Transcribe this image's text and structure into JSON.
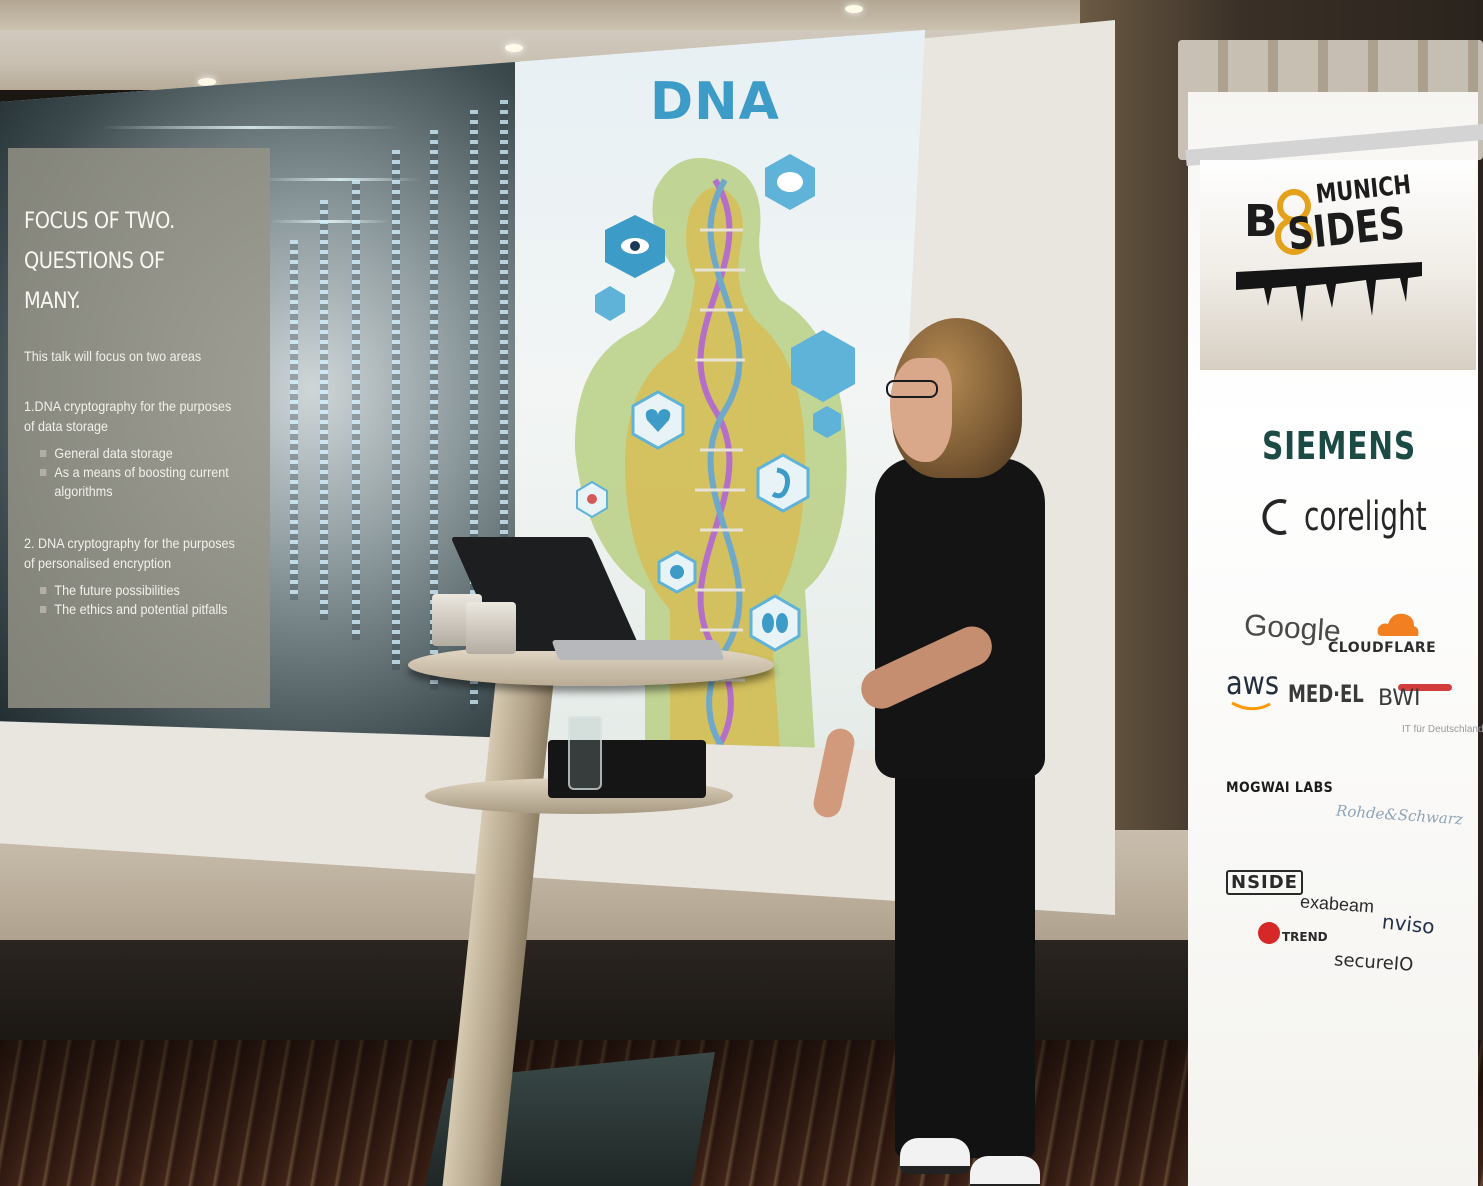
{
  "slide": {
    "heading_lines": [
      "FOCUS OF TWO.",
      "QUESTIONS OF",
      "MANY."
    ],
    "intro": "This talk will focus on two areas",
    "points": [
      {
        "title_lines": [
          "1.DNA cryptography for the purposes",
          "of data storage"
        ],
        "subpoints": [
          "General data storage",
          "As a means of boosting current algorithms"
        ]
      },
      {
        "title_lines": [
          "2. DNA cryptography for the purposes",
          "of personalised encryption"
        ],
        "subpoints": [
          "The future possibilities",
          "The ethics and potential pitfalls"
        ]
      }
    ],
    "image_title": "DNA"
  },
  "banner": {
    "logo": {
      "b": "B",
      "munich": "MUNICH",
      "sides": "SIDES"
    },
    "sponsors": {
      "siemens": "SIEMENS",
      "corelight": "corelight",
      "google": "Google",
      "cloudflare": "CLOUDFLARE",
      "aws": "aws",
      "medel": "MED·EL",
      "bwi": "BWI",
      "bwi_sub": "IT für Deutschland",
      "mogwai": "MOGWAI LABS",
      "script_logo": "Rohde&Schwarz",
      "nside": "NSIDE",
      "exabeam": "exabeam",
      "nviso": "nviso",
      "trend": "TREND",
      "secureio": "secureIO"
    }
  },
  "colors": {
    "dna_title": "#3d9bc7",
    "siemens": "#1c4a45",
    "cloudflare": "#f38020",
    "trend": "#d62828",
    "bwi_bar": "#d43d3d"
  },
  "icons": [
    "eye-icon",
    "brain-icon",
    "heart-icon",
    "stomach-icon",
    "kidney-icon",
    "lung-icon"
  ]
}
